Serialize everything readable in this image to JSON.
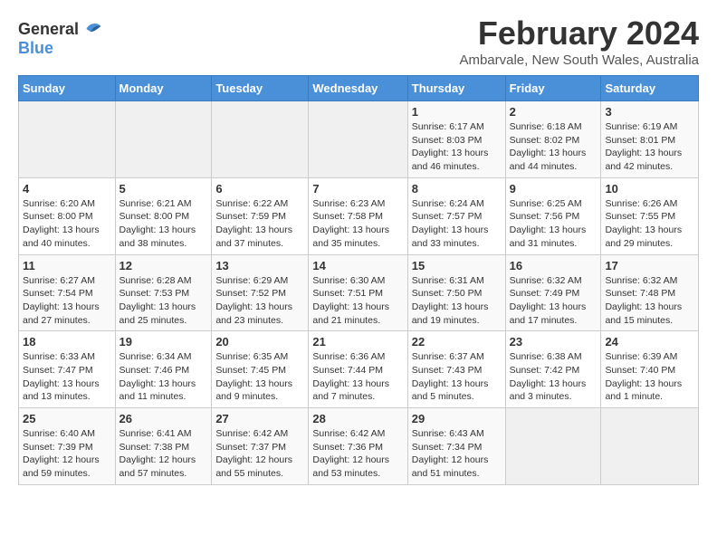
{
  "logo": {
    "text_general": "General",
    "text_blue": "Blue"
  },
  "header": {
    "title": "February 2024",
    "subtitle": "Ambarvale, New South Wales, Australia"
  },
  "weekdays": [
    "Sunday",
    "Monday",
    "Tuesday",
    "Wednesday",
    "Thursday",
    "Friday",
    "Saturday"
  ],
  "weeks": [
    [
      {
        "day": "",
        "info": ""
      },
      {
        "day": "",
        "info": ""
      },
      {
        "day": "",
        "info": ""
      },
      {
        "day": "",
        "info": ""
      },
      {
        "day": "1",
        "info": "Sunrise: 6:17 AM\nSunset: 8:03 PM\nDaylight: 13 hours and 46 minutes."
      },
      {
        "day": "2",
        "info": "Sunrise: 6:18 AM\nSunset: 8:02 PM\nDaylight: 13 hours and 44 minutes."
      },
      {
        "day": "3",
        "info": "Sunrise: 6:19 AM\nSunset: 8:01 PM\nDaylight: 13 hours and 42 minutes."
      }
    ],
    [
      {
        "day": "4",
        "info": "Sunrise: 6:20 AM\nSunset: 8:00 PM\nDaylight: 13 hours and 40 minutes."
      },
      {
        "day": "5",
        "info": "Sunrise: 6:21 AM\nSunset: 8:00 PM\nDaylight: 13 hours and 38 minutes."
      },
      {
        "day": "6",
        "info": "Sunrise: 6:22 AM\nSunset: 7:59 PM\nDaylight: 13 hours and 37 minutes."
      },
      {
        "day": "7",
        "info": "Sunrise: 6:23 AM\nSunset: 7:58 PM\nDaylight: 13 hours and 35 minutes."
      },
      {
        "day": "8",
        "info": "Sunrise: 6:24 AM\nSunset: 7:57 PM\nDaylight: 13 hours and 33 minutes."
      },
      {
        "day": "9",
        "info": "Sunrise: 6:25 AM\nSunset: 7:56 PM\nDaylight: 13 hours and 31 minutes."
      },
      {
        "day": "10",
        "info": "Sunrise: 6:26 AM\nSunset: 7:55 PM\nDaylight: 13 hours and 29 minutes."
      }
    ],
    [
      {
        "day": "11",
        "info": "Sunrise: 6:27 AM\nSunset: 7:54 PM\nDaylight: 13 hours and 27 minutes."
      },
      {
        "day": "12",
        "info": "Sunrise: 6:28 AM\nSunset: 7:53 PM\nDaylight: 13 hours and 25 minutes."
      },
      {
        "day": "13",
        "info": "Sunrise: 6:29 AM\nSunset: 7:52 PM\nDaylight: 13 hours and 23 minutes."
      },
      {
        "day": "14",
        "info": "Sunrise: 6:30 AM\nSunset: 7:51 PM\nDaylight: 13 hours and 21 minutes."
      },
      {
        "day": "15",
        "info": "Sunrise: 6:31 AM\nSunset: 7:50 PM\nDaylight: 13 hours and 19 minutes."
      },
      {
        "day": "16",
        "info": "Sunrise: 6:32 AM\nSunset: 7:49 PM\nDaylight: 13 hours and 17 minutes."
      },
      {
        "day": "17",
        "info": "Sunrise: 6:32 AM\nSunset: 7:48 PM\nDaylight: 13 hours and 15 minutes."
      }
    ],
    [
      {
        "day": "18",
        "info": "Sunrise: 6:33 AM\nSunset: 7:47 PM\nDaylight: 13 hours and 13 minutes."
      },
      {
        "day": "19",
        "info": "Sunrise: 6:34 AM\nSunset: 7:46 PM\nDaylight: 13 hours and 11 minutes."
      },
      {
        "day": "20",
        "info": "Sunrise: 6:35 AM\nSunset: 7:45 PM\nDaylight: 13 hours and 9 minutes."
      },
      {
        "day": "21",
        "info": "Sunrise: 6:36 AM\nSunset: 7:44 PM\nDaylight: 13 hours and 7 minutes."
      },
      {
        "day": "22",
        "info": "Sunrise: 6:37 AM\nSunset: 7:43 PM\nDaylight: 13 hours and 5 minutes."
      },
      {
        "day": "23",
        "info": "Sunrise: 6:38 AM\nSunset: 7:42 PM\nDaylight: 13 hours and 3 minutes."
      },
      {
        "day": "24",
        "info": "Sunrise: 6:39 AM\nSunset: 7:40 PM\nDaylight: 13 hours and 1 minute."
      }
    ],
    [
      {
        "day": "25",
        "info": "Sunrise: 6:40 AM\nSunset: 7:39 PM\nDaylight: 12 hours and 59 minutes."
      },
      {
        "day": "26",
        "info": "Sunrise: 6:41 AM\nSunset: 7:38 PM\nDaylight: 12 hours and 57 minutes."
      },
      {
        "day": "27",
        "info": "Sunrise: 6:42 AM\nSunset: 7:37 PM\nDaylight: 12 hours and 55 minutes."
      },
      {
        "day": "28",
        "info": "Sunrise: 6:42 AM\nSunset: 7:36 PM\nDaylight: 12 hours and 53 minutes."
      },
      {
        "day": "29",
        "info": "Sunrise: 6:43 AM\nSunset: 7:34 PM\nDaylight: 12 hours and 51 minutes."
      },
      {
        "day": "",
        "info": ""
      },
      {
        "day": "",
        "info": ""
      }
    ]
  ]
}
